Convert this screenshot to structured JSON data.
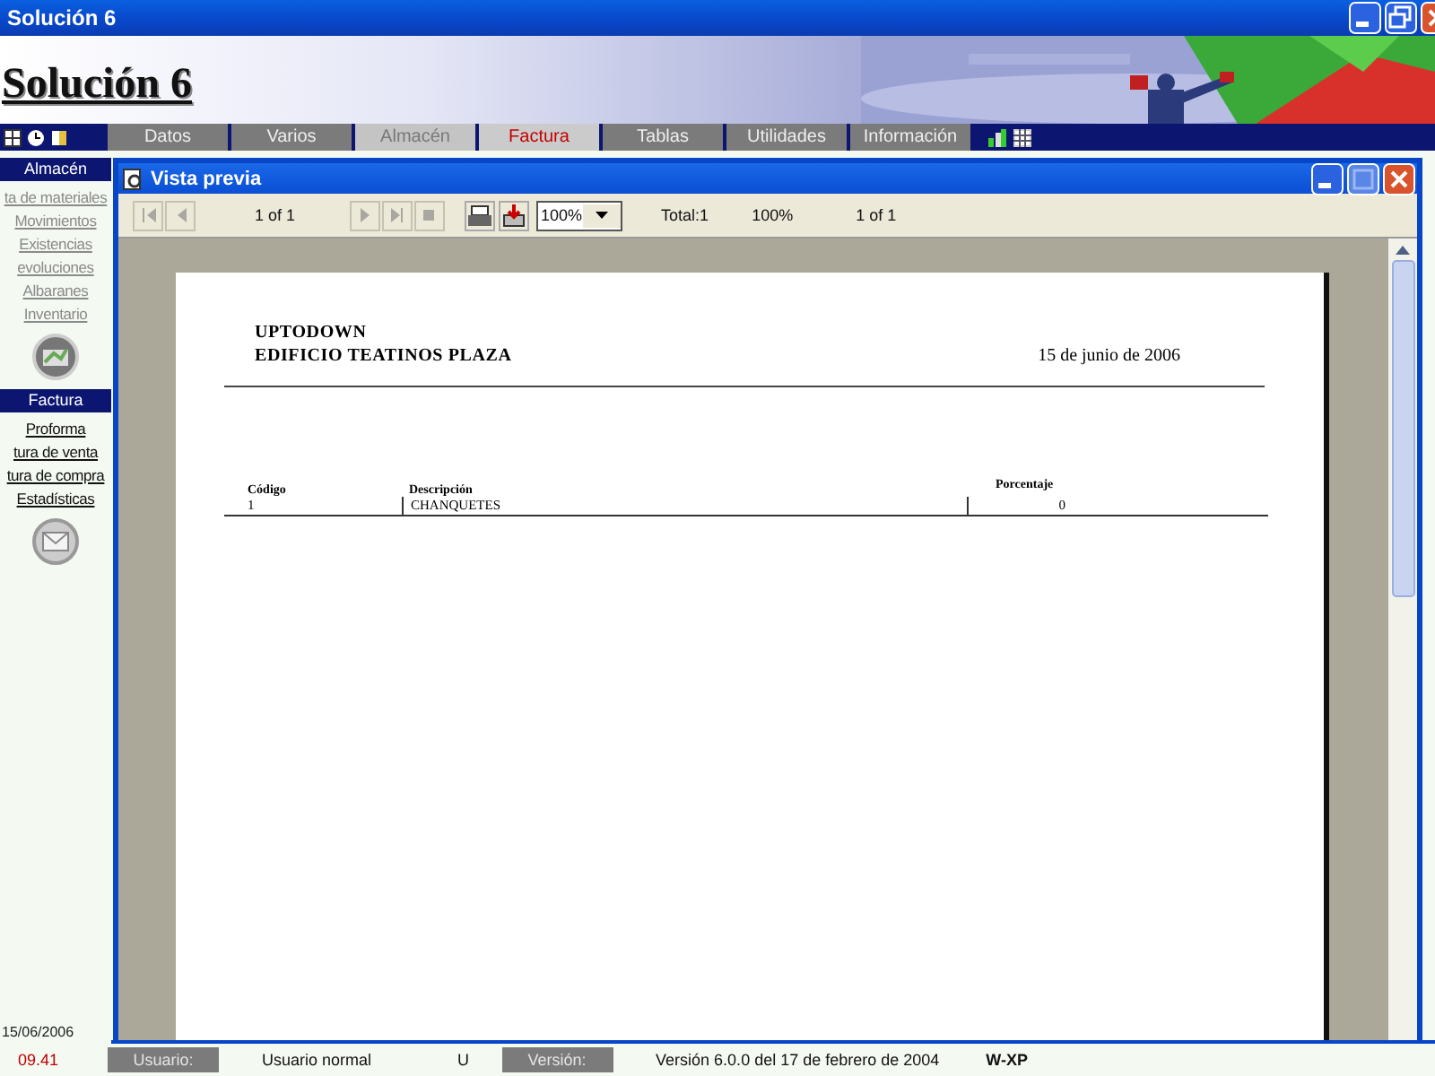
{
  "window": {
    "title": "Solución 6"
  },
  "banner": {
    "title": "Solución 6"
  },
  "menu_tabs": [
    {
      "label": "Datos",
      "selected": false,
      "disabled": false
    },
    {
      "label": "Varios",
      "selected": false,
      "disabled": false
    },
    {
      "label": "Almacén",
      "selected": false,
      "disabled": true
    },
    {
      "label": "Factura",
      "selected": true,
      "disabled": false
    },
    {
      "label": "Tablas",
      "selected": false,
      "disabled": false
    },
    {
      "label": "Utilidades",
      "selected": false,
      "disabled": false
    },
    {
      "label": "Información",
      "selected": false,
      "disabled": false
    }
  ],
  "sidebar": {
    "sections": [
      {
        "title": "Almacén",
        "items": [
          {
            "label": "ta de materiales",
            "disabled": true
          },
          {
            "label": "Movimientos",
            "disabled": true
          },
          {
            "label": "Existencias",
            "disabled": true
          },
          {
            "label": "evoluciones",
            "disabled": true
          },
          {
            "label": "Albaranes",
            "disabled": true
          },
          {
            "label": "Inventario",
            "disabled": true
          }
        ]
      },
      {
        "title": "Factura",
        "items": [
          {
            "label": "Proforma",
            "disabled": false
          },
          {
            "label": "tura de venta",
            "disabled": false
          },
          {
            "label": "tura de compra",
            "disabled": false
          },
          {
            "label": "Estadísticas",
            "disabled": false
          }
        ]
      }
    ],
    "date": "15/06/2006",
    "time": "09.41"
  },
  "preview": {
    "title": "Vista previa",
    "nav_before": [
      {
        "kind": "first",
        "disabled": true
      },
      {
        "kind": "prev",
        "disabled": true
      }
    ],
    "page_indicator": "1 of 1",
    "nav_after": [
      {
        "kind": "next",
        "disabled": true
      },
      {
        "kind": "last",
        "disabled": true
      },
      {
        "kind": "stop",
        "disabled": true
      }
    ],
    "zoom": "100%",
    "total": "Total:1",
    "zoom_reading": "100%",
    "page_reading": "1 of 1",
    "report": {
      "company": "UPTODOWN",
      "address": "EDIFICIO TEATINOS PLAZA",
      "date": "15 de junio de 2006",
      "columns": [
        "Código",
        "Descripción",
        "Porcentaje"
      ],
      "rows": [
        [
          "1",
          "CHANQUETES",
          "0"
        ]
      ]
    }
  },
  "status_bar": [
    {
      "kind": "label",
      "text": "Usuario:"
    },
    {
      "kind": "value",
      "text": "Usuario normal"
    },
    {
      "kind": "value",
      "text": "U"
    },
    {
      "kind": "label",
      "text": "Versión:"
    },
    {
      "kind": "value",
      "text": "Versión 6.0.0 del 17 de febrero de 2004"
    },
    {
      "kind": "strong",
      "text": "W-XP"
    }
  ]
}
